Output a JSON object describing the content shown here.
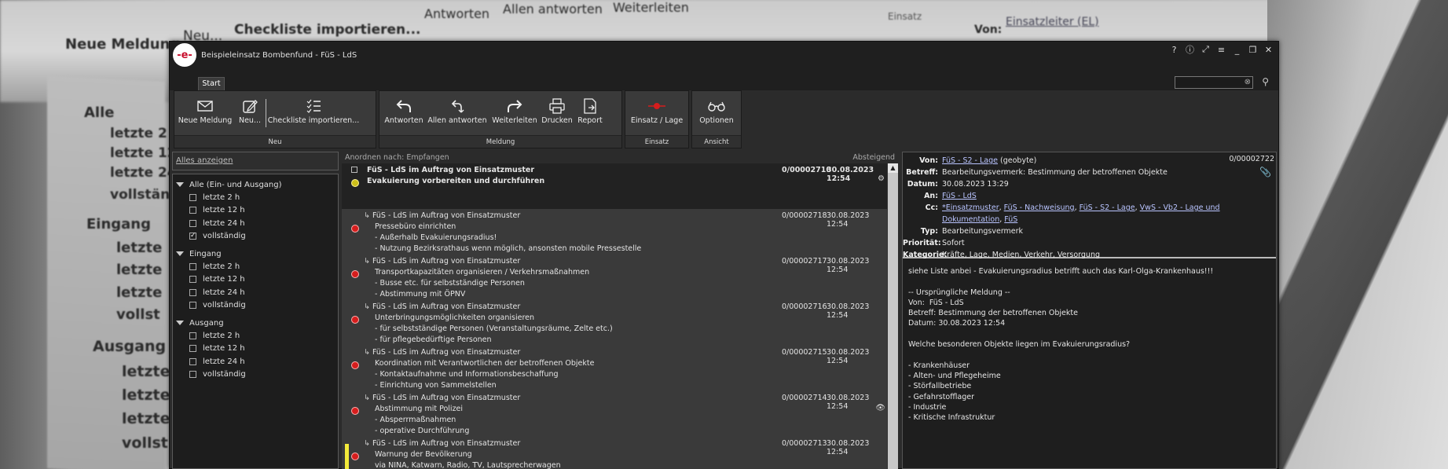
{
  "background": {
    "texts": [
      "Neue Meldung",
      "Neu...",
      "Checkliste importieren...",
      "Antworten",
      "Allen antworten",
      "Weiterleiten",
      "Einsatz",
      "Von:",
      "Einsatzleiter (EL)",
      "Alle",
      "letzte 2",
      "letzte 12",
      "letzte 24",
      "vollständ",
      "Eingang",
      "letzte",
      "letzte",
      "letzte",
      "vollst",
      "Ausgang",
      "letzte",
      "letzte",
      "letzte",
      "vollst"
    ]
  },
  "window": {
    "title": "Beispieleinsatz Bombenfund - FüS - LdS",
    "logo": "-e-",
    "tab": "Start",
    "search_placeholder": ""
  },
  "ribbon": {
    "groups": [
      {
        "label": "Neu",
        "buttons": [
          "Neue Meldung",
          "Neu...",
          "Checkliste importieren..."
        ]
      },
      {
        "label": "Meldung",
        "buttons": [
          "Antworten",
          "Allen antworten",
          "Weiterleiten",
          "Drucken",
          "Report"
        ]
      },
      {
        "label": "Einsatz",
        "buttons": [
          "Einsatz / Lage"
        ]
      },
      {
        "label": "Ansicht",
        "buttons": [
          "Optionen"
        ]
      }
    ]
  },
  "left_panel": {
    "show_all": "Alles anzeigen",
    "groups": [
      {
        "label": "Alle (Ein- und Ausgang)",
        "items": [
          {
            "label": "letzte 2 h",
            "checked": false
          },
          {
            "label": "letzte 12 h",
            "checked": false
          },
          {
            "label": "letzte 24 h",
            "checked": false
          },
          {
            "label": "vollständig",
            "checked": true
          }
        ]
      },
      {
        "label": "Eingang",
        "items": [
          {
            "label": "letzte 2 h",
            "checked": false
          },
          {
            "label": "letzte 12 h",
            "checked": false
          },
          {
            "label": "letzte 24 h",
            "checked": false
          },
          {
            "label": "vollständig",
            "checked": false
          }
        ]
      },
      {
        "label": "Ausgang",
        "items": [
          {
            "label": "letzte 2 h",
            "checked": false
          },
          {
            "label": "letzte 12 h",
            "checked": false
          },
          {
            "label": "letzte 24 h",
            "checked": false
          },
          {
            "label": "vollständig",
            "checked": false
          }
        ]
      }
    ]
  },
  "list": {
    "sort_label": "Anordnen nach: Empfangen",
    "order": "Absteigend",
    "messages": [
      {
        "sender": "FüS - LdS im Auftrag von Einsatzmuster",
        "num": "0/00002710",
        "date": "30.08.2023 12:54",
        "lines": [
          "Evakuierung vorbereiten und durchführen"
        ],
        "dot": "yellow",
        "first": true
      },
      {
        "sender": "FüS - LdS im Auftrag von Einsatzmuster",
        "num": "0/00002718",
        "date": "30.08.2023 12:54",
        "lines": [
          "Pressebüro einrichten",
          "- Außerhalb Evakuierungsradius!",
          "- Nutzung Bezirksrathaus wenn möglich, ansonsten mobile Pressestelle"
        ],
        "dot": "red"
      },
      {
        "sender": "FüS - LdS im Auftrag von Einsatzmuster",
        "num": "0/00002717",
        "date": "30.08.2023 12:54",
        "lines": [
          "Transportkapazitäten organisieren / Verkehrsmaßnahmen",
          "- Busse etc. für selbstständige Personen",
          "- Abstimmung mit ÖPNV"
        ],
        "dot": "red"
      },
      {
        "sender": "FüS - LdS im Auftrag von Einsatzmuster",
        "num": "0/00002716",
        "date": "30.08.2023 12:54",
        "lines": [
          "Unterbringungsmöglichkeiten organisieren",
          "- für selbstständige Personen (Veranstaltungsräume, Zelte etc.)",
          "- für pflegebedürftige Personen"
        ],
        "dot": "red"
      },
      {
        "sender": "FüS - LdS im Auftrag von Einsatzmuster",
        "num": "0/00002715",
        "date": "30.08.2023 12:54",
        "lines": [
          "Koordination mit Verantwortlichen der betroffenen Objekte",
          "- Kontaktaufnahme und Informationsbeschaffung",
          "- Einrichtung von Sammelstellen"
        ],
        "dot": "red"
      },
      {
        "sender": "FüS - LdS im Auftrag von Einsatzmuster",
        "num": "0/00002714",
        "date": "30.08.2023 12:54",
        "lines": [
          "Abstimmung mit Polizei",
          "- Absperrmaßnahmen",
          "- operative Durchführung"
        ],
        "dot": "red"
      },
      {
        "sender": "FüS - LdS im Auftrag von Einsatzmuster",
        "num": "0/00002713",
        "date": "30.08.2023 12:54",
        "lines": [
          "Warnung der Bevölkerung",
          "via NINA, Katwarn, Radio, TV, Lautsprecherwagen"
        ],
        "dot": "red"
      }
    ]
  },
  "detail": {
    "number": "0/00002722",
    "von_label": "Von:",
    "von_link": "FüS - S2 - Lage",
    "von_extra": " (geobyte)",
    "betreff_label": "Betreff:",
    "betreff": "Bearbeitungsvermerk: Bestimmung der betroffenen Objekte",
    "datum_label": "Datum:",
    "datum": "30.08.2023 13:29",
    "an_label": "An:",
    "an_link": "FüS - LdS",
    "cc_label": "Cc:",
    "cc_links": [
      "*Einsatzmuster",
      "FüS - Nachweisung",
      "FüS - S2 - Lage",
      "VwS - Vb2 - Lage und Dokumentation",
      "FüS"
    ],
    "typ_label": "Typ:",
    "typ": "Bearbeitungsvermerk",
    "prio_label": "Priorität:",
    "prio": "Sofort",
    "kat_label": "Kategorie:",
    "kat": "Kräfte, Lage, Medien, Verkehr, Versorgung",
    "body": [
      "siehe Liste anbei - Evakuierungsradius betrifft auch das Karl-Olga-Krankenhaus!!!",
      "",
      "-- Ursprüngliche Meldung --",
      "Von:  FüS - LdS",
      "Betreff: Bestimmung der betroffenen Objekte",
      "Datum: 30.08.2023 12:54",
      "",
      "Welche besonderen Objekte liegen im Evakuierungsradius?",
      "",
      "- Krankenhäuser",
      "- Alten- und Pflegeheime",
      "- Störfallbetriebe",
      "- Gefahrstofflager",
      "- Industrie",
      "- Kritische Infrastruktur"
    ]
  }
}
